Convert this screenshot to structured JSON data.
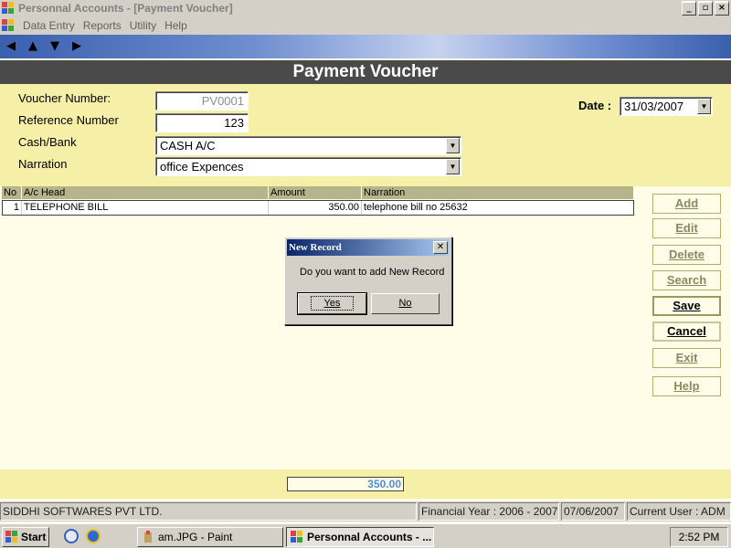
{
  "window": {
    "title": "Personnal Accounts - [Payment Voucher]"
  },
  "menu": {
    "items": [
      "Data Entry",
      "Reports",
      "Utility",
      "Help"
    ]
  },
  "header": {
    "title": "Payment Voucher"
  },
  "form": {
    "voucher_number_label": "Voucher Number:",
    "voucher_number_value": "PV0001",
    "reference_number_label": "Reference Number",
    "reference_number_value": "123",
    "cash_bank_label": "Cash/Bank",
    "cash_bank_value": "CASH A/C",
    "narration_label": "Narration",
    "narration_value": "office Expences",
    "date_label": "Date :",
    "date_value": "31/03/2007"
  },
  "grid": {
    "columns": [
      "No",
      "A/c Head",
      "Amount",
      "Narration"
    ],
    "rows": [
      {
        "no": "1",
        "ac_head": "TELEPHONE BILL",
        "amount": "350.00",
        "narration": "telephone bill no 25632"
      }
    ]
  },
  "buttons": {
    "add": "Add",
    "edit": "Edit",
    "delete": "Delete",
    "search": "Search",
    "save": "Save",
    "cancel": "Cancel",
    "exit": "Exit",
    "help": "Help"
  },
  "dialog": {
    "title": "New Record",
    "message": "Do you want to add New Record",
    "yes": "Yes",
    "no": "No"
  },
  "footer": {
    "total": "350.00"
  },
  "statusbar": {
    "company": "SIDDHI SOFTWARES PVT LTD.",
    "financial_year": "Financial Year : 2006 - 2007",
    "date": "07/06/2007",
    "user": "Current User : ADM"
  },
  "taskbar": {
    "start": "Start",
    "tasks": [
      "am.JPG - Paint",
      "Personnal Accounts - ..."
    ],
    "clock": "2:52 PM"
  },
  "colors": {
    "form_bg": "#f5efa8",
    "body_bg": "#fffde8",
    "header_bg": "#4a4a4a",
    "total_text": "#4f8fe0"
  }
}
